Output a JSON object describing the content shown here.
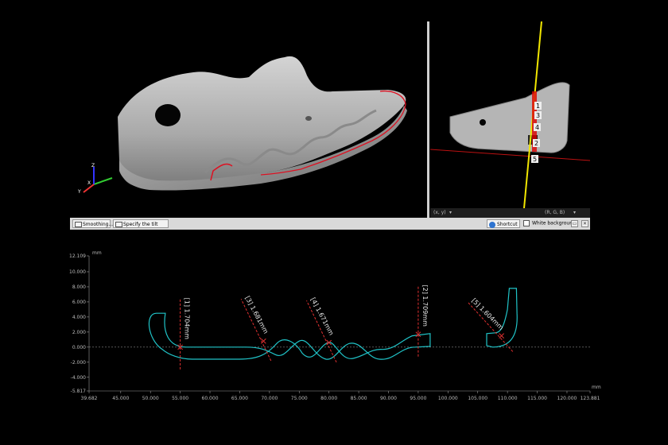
{
  "views": {
    "left_view_label": "",
    "right_view_coords": "(x, y)",
    "right_view_color": "(R, G, B)",
    "section_markers": [
      "1",
      "3",
      "4",
      "2",
      "5"
    ]
  },
  "toolbar": {
    "smoothing_label": "Smoothing...",
    "tilt_origin_label": "Specify the tilt origin...",
    "shortcut_label": "Shortcut",
    "white_background_label": "White background",
    "white_background_checked": false
  },
  "axis_icon": {
    "x": "X",
    "y": "Y",
    "z": "Z"
  },
  "chart_data": {
    "type": "line",
    "title": "",
    "xlabel": "mm",
    "ylabel": "mm",
    "xlim": [
      39.682,
      123.881
    ],
    "ylim": [
      -5.817,
      12.109
    ],
    "x_ticks": [
      "39.682",
      "45.000",
      "50.000",
      "55.000",
      "60.000",
      "65.000",
      "70.000",
      "75.000",
      "80.000",
      "85.000",
      "90.000",
      "95.000",
      "100.000",
      "105.000",
      "110.000",
      "115.000",
      "120.000",
      "123.881"
    ],
    "y_ticks": [
      "12.109",
      "10.000",
      "8.000",
      "6.000",
      "4.000",
      "2.000",
      "0.000",
      "-2.000",
      "-4.000",
      "-5.817"
    ],
    "grid": false,
    "measurements": [
      {
        "label": "[1] 1.704mm",
        "x": 55.0,
        "y": 0.0
      },
      {
        "label": "[3] 1.681mm",
        "x": 69.0,
        "y": 0.8
      },
      {
        "label": "[4] 1.671mm",
        "x": 80.0,
        "y": 0.6
      },
      {
        "label": "[2] 1.709mm",
        "x": 95.0,
        "y": 1.7
      },
      {
        "label": "[5] 1.604mm",
        "x": 109.0,
        "y": 1.5
      }
    ]
  }
}
